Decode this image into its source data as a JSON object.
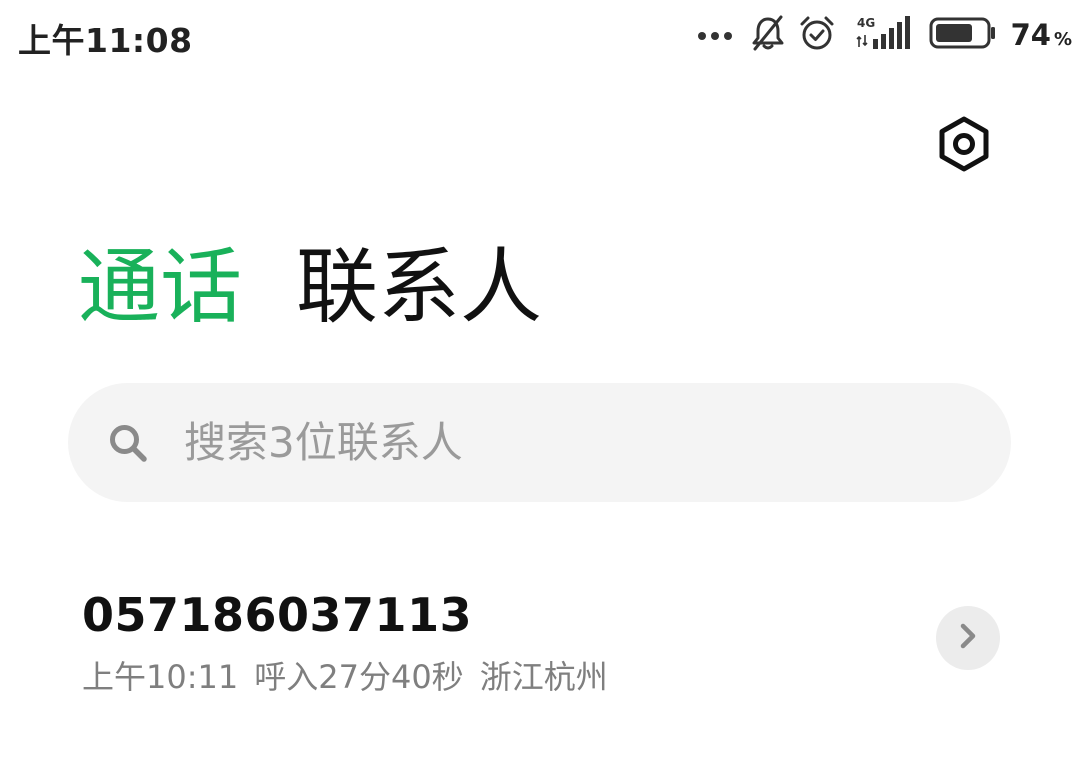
{
  "status_bar": {
    "time": "上午11:08",
    "network_label": "4G",
    "battery_percent": "74",
    "battery_percent_sign": "%",
    "battery_level": 0.74,
    "icons": [
      "more-dots-icon",
      "bell-off-icon",
      "alarm-icon",
      "signal-4g-icon",
      "battery-icon"
    ]
  },
  "settings": {
    "icon": "settings-hexagon-icon"
  },
  "tabs": [
    {
      "label": "通话",
      "active": true,
      "color": "#19b15a"
    },
    {
      "label": "联系人",
      "active": false,
      "color": "#111111"
    }
  ],
  "search": {
    "placeholder": "搜索3位联系人",
    "value": "",
    "icon": "search-icon"
  },
  "call_log": [
    {
      "number": "057186037113",
      "time": "上午10:11",
      "direction_duration": "呼入27分40秒",
      "location": "浙江杭州",
      "action_icon": "chevron-right-icon"
    }
  ],
  "colors": {
    "accent": "#19b15a",
    "search_bg": "#f4f4f4",
    "secondary_text": "#7f7f7f"
  }
}
